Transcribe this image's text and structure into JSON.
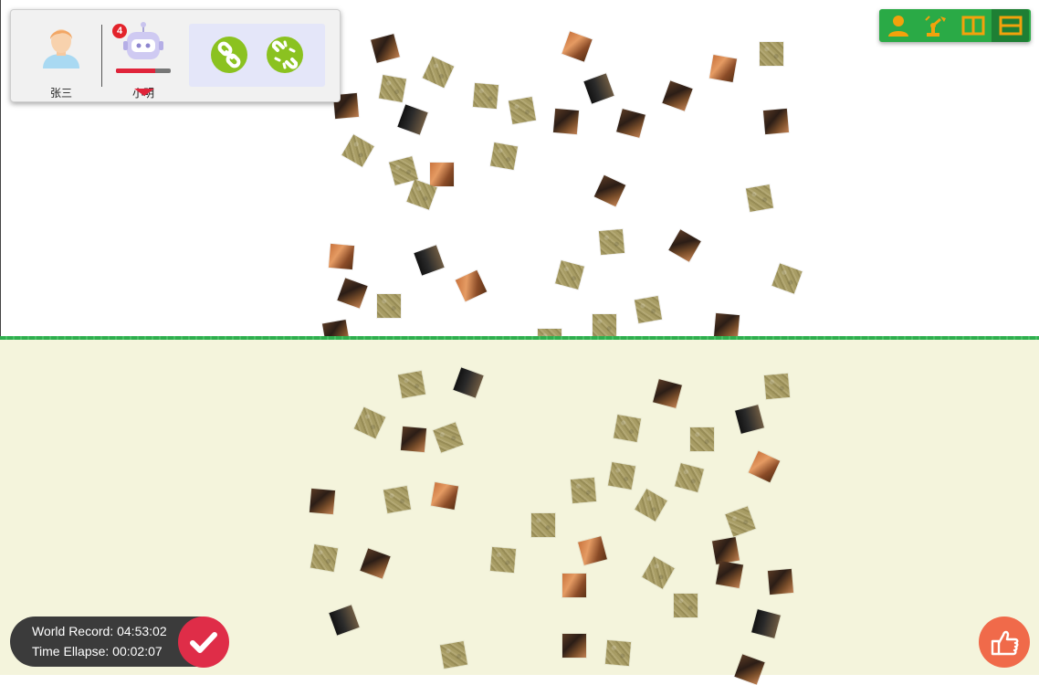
{
  "players": {
    "human": {
      "name": "张三",
      "icon": "human-avatar-icon"
    },
    "robot": {
      "name": "小明",
      "icon": "robot-avatar-icon",
      "badge_count": "4",
      "progress_fraction": 0.72
    }
  },
  "link_controls": {
    "link": {
      "icon": "link-icon"
    },
    "unlink": {
      "icon": "unlink-icon"
    }
  },
  "mode_bar": {
    "buttons": [
      {
        "icon": "person-icon",
        "active": false
      },
      {
        "icon": "robot-arm-icon",
        "active": false
      },
      {
        "icon": "split-columns-icon",
        "active": false
      },
      {
        "icon": "split-rows-icon",
        "active": true
      }
    ]
  },
  "record": {
    "world_record": "World Record: 04:53:02",
    "time_elapsed": "Time Ellapse: 00:02:07"
  },
  "actions": {
    "confirm": {
      "icon": "check-icon"
    },
    "hint": {
      "icon": "hand-pointer-icon"
    }
  },
  "colors": {
    "divider": "#2fae4e",
    "bottom_background": "#f4f4dc",
    "badge": "#e3232b",
    "link_button": "#8bc220",
    "mode_bar": "#2aaa46",
    "confirm_button": "#df2d48",
    "hint_button": "#f06a4a"
  }
}
